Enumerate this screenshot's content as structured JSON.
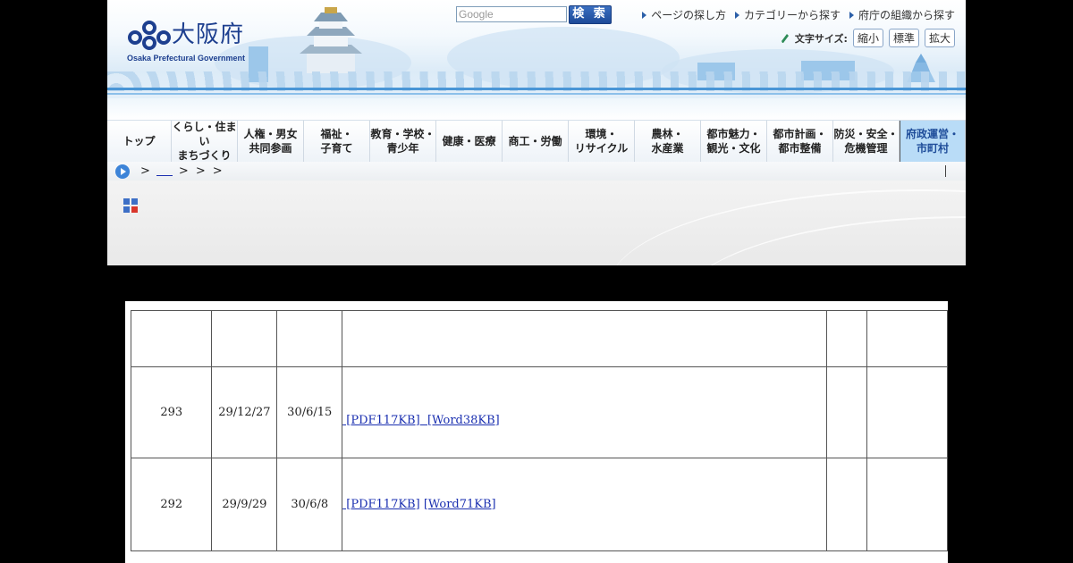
{
  "header": {
    "logo_text": "大阪府",
    "logo_sub": "Osaka Prefectural Government",
    "search_placeholder": "Google",
    "search_button": "検 索",
    "top_links": [
      "ページの探し方",
      "カテゴリーから探す",
      "府庁の組織から探す"
    ],
    "font_size_label": "文字サイズ:",
    "font_size_buttons": [
      "縮小",
      "標準",
      "拡大"
    ]
  },
  "nav": {
    "items": [
      "トップ",
      "くらし・住まい\nまちづくり",
      "人権・男女\n共同参画",
      "福祉・\n子育て",
      "教育・学校・\n青少年",
      "健康・医療",
      "商工・労働",
      "環境・\nリサイクル",
      "農林・\n水産業",
      "都市魅力・\n観光・文化",
      "都市計画・\n都市整備",
      "防災・安全・\n危機管理",
      "府政運営・\n市町村"
    ]
  },
  "breadcrumb": {
    "sep": ">"
  },
  "table": {
    "rows": [
      {
        "no": "293",
        "date1": "29/12/27",
        "date2": "30/6/15",
        "links": [
          " [PDF117KB]",
          "  [Word38KB]"
        ]
      },
      {
        "no": "292",
        "date1": "29/9/29",
        "date2": "30/6/8",
        "links": [
          " [PDF117KB]",
          "[Word71KB]"
        ]
      }
    ]
  },
  "colors": {
    "brand": "#1d3f8f",
    "nav_active": "#b9dcf7",
    "link": "#1a2fb0"
  }
}
